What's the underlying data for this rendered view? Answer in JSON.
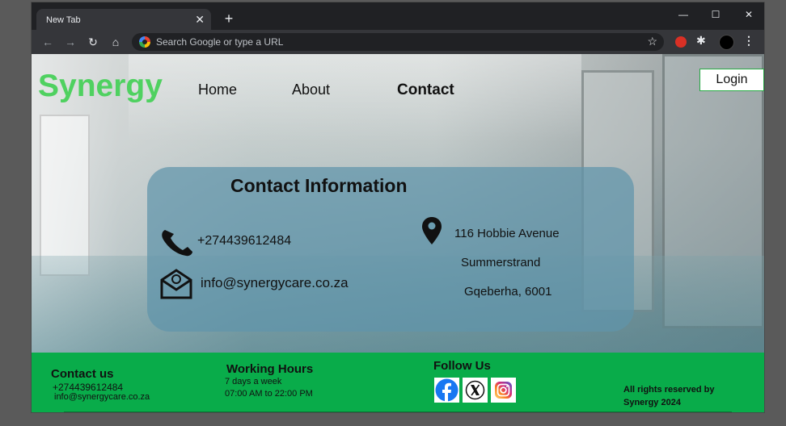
{
  "browser": {
    "tab_title": "New Tab",
    "tab_close": "✕",
    "new_tab": "+",
    "window_controls": {
      "minimize": "—",
      "maximize": "☐",
      "close": "✕"
    },
    "nav": {
      "back": "←",
      "forward": "→",
      "reload": "↻",
      "home": "⌂"
    },
    "omnibox_placeholder": "Search Google or type a URL",
    "bookmark": "☆",
    "extensions_icon": "✱",
    "menu": "⋮"
  },
  "site": {
    "logo": "Synergy",
    "nav": {
      "home": "Home",
      "about": "About",
      "contact": "Contact"
    },
    "login": "Login",
    "brand_color": "#4fd160",
    "footer_color": "#09ac4a"
  },
  "contact_card": {
    "title": "Contact Information",
    "phone": "+274439612484",
    "email": "info@synergycare.co.za",
    "address": {
      "line1": "116 Hobbie Avenue",
      "line2": "Summerstrand",
      "line3": "Gqeberha, 6001"
    }
  },
  "footer": {
    "contact": {
      "heading": "Contact us",
      "phone": "+274439612484",
      "email": "info@synergycare.co.za"
    },
    "hours": {
      "heading": "Working Hours",
      "days": "7 days a week",
      "time": "07:00 AM to 22:00 PM"
    },
    "follow": {
      "heading": "Follow Us",
      "icons": [
        "facebook-icon",
        "x-icon",
        "instagram-icon"
      ]
    },
    "copyright": {
      "line1": "All rights reserved by",
      "line2": "Synergy 2024"
    }
  }
}
